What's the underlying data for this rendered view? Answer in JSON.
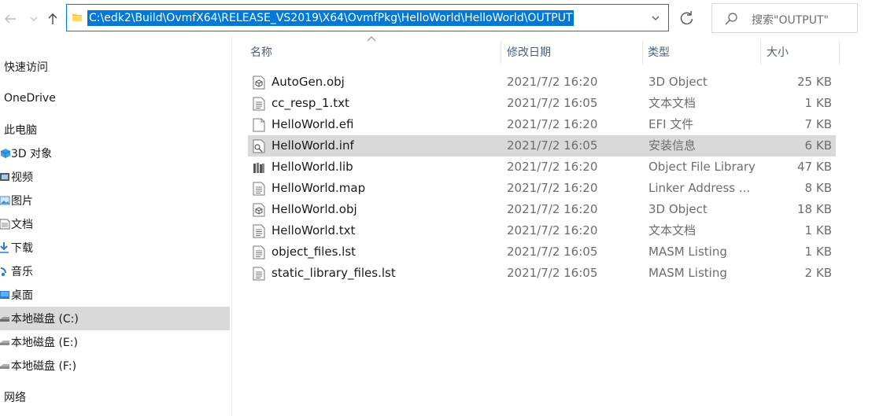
{
  "address_bar": {
    "path": "C:\\edk2\\Build\\OvmfX64\\RELEASE_VS2019\\X64\\OvmfPkg\\HelloWorld\\HelloWorld\\OUTPUT"
  },
  "search": {
    "placeholder": "搜索\"OUTPUT\""
  },
  "sidebar": {
    "quick_access": "快速访问",
    "onedrive": "OneDrive",
    "this_pc": "此电脑",
    "items": [
      {
        "label": "3D 对象",
        "icon": "3d-objects-icon"
      },
      {
        "label": "视频",
        "icon": "video-icon"
      },
      {
        "label": "图片",
        "icon": "pictures-icon"
      },
      {
        "label": "文档",
        "icon": "documents-icon"
      },
      {
        "label": "下载",
        "icon": "download-icon"
      },
      {
        "label": "音乐",
        "icon": "music-icon"
      },
      {
        "label": "桌面",
        "icon": "desktop-icon"
      },
      {
        "label": "本地磁盘 (C:)",
        "icon": "drive-icon"
      },
      {
        "label": "本地磁盘 (E:)",
        "icon": "drive-icon"
      },
      {
        "label": "本地磁盘 (F:)",
        "icon": "drive-icon"
      }
    ],
    "network": "网络"
  },
  "columns": {
    "name": "名称",
    "date": "修改日期",
    "type": "类型",
    "size": "大小"
  },
  "files": [
    {
      "name": "AutoGen.obj",
      "date": "2021/7/2 16:20",
      "type": "3D Object",
      "size": "25 KB",
      "icon": "3d-object-file-icon"
    },
    {
      "name": "cc_resp_1.txt",
      "date": "2021/7/2 16:05",
      "type": "文本文档",
      "size": "1 KB",
      "icon": "text-file-icon"
    },
    {
      "name": "HelloWorld.efi",
      "date": "2021/7/2 16:20",
      "type": "EFI 文件",
      "size": "7 KB",
      "icon": "generic-file-icon"
    },
    {
      "name": "HelloWorld.inf",
      "date": "2021/7/2 16:05",
      "type": "安装信息",
      "size": "6 KB",
      "icon": "setup-info-file-icon"
    },
    {
      "name": "HelloWorld.lib",
      "date": "2021/7/2 16:20",
      "type": "Object File Library",
      "size": "47 KB",
      "icon": "library-file-icon"
    },
    {
      "name": "HelloWorld.map",
      "date": "2021/7/2 16:20",
      "type": "Linker Address ...",
      "size": "8 KB",
      "icon": "text-file-icon"
    },
    {
      "name": "HelloWorld.obj",
      "date": "2021/7/2 16:20",
      "type": "3D Object",
      "size": "18 KB",
      "icon": "3d-object-file-icon"
    },
    {
      "name": "HelloWorld.txt",
      "date": "2021/7/2 16:20",
      "type": "文本文档",
      "size": "1 KB",
      "icon": "text-file-icon"
    },
    {
      "name": "object_files.lst",
      "date": "2021/7/2 16:05",
      "type": "MASM Listing",
      "size": "1 KB",
      "icon": "text-file-icon"
    },
    {
      "name": "static_library_files.lst",
      "date": "2021/7/2 16:05",
      "type": "MASM Listing",
      "size": "2 KB",
      "icon": "text-file-icon"
    }
  ]
}
